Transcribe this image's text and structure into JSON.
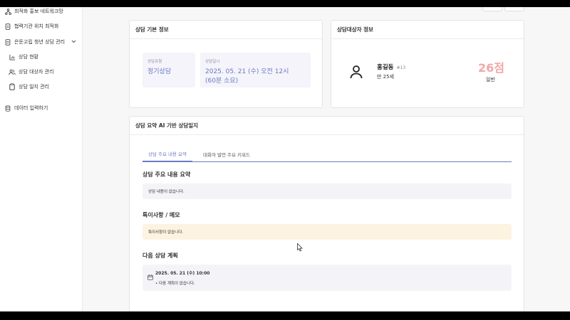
{
  "sidebar": {
    "items": [
      {
        "label": "최적화 홍보 네트워크망",
        "icon": "network-icon"
      },
      {
        "label": "협력기관 위치 최적화",
        "icon": "document-icon"
      },
      {
        "label": "은둔고립 청년 상담 관리",
        "icon": "document-icon"
      },
      {
        "label": "상담 현황",
        "icon": "chart-icon"
      },
      {
        "label": "상담 대상자 관리",
        "icon": "users-icon"
      },
      {
        "label": "상담 일지 관리",
        "icon": "clipboard-icon"
      },
      {
        "label": "데이터 입력하기",
        "icon": "database-icon"
      }
    ]
  },
  "basic_info": {
    "header": "상담 기본 정보",
    "type_label": "상담유형",
    "type_value": "정기상담",
    "datetime_label": "상담일시",
    "datetime_value": "2025. 05. 21 (수) 오전 12시",
    "duration_value": "(60분 소요)"
  },
  "client_info": {
    "header": "상담대상자 정보",
    "name": "홍길동",
    "id_tag": "#13",
    "age": "만 25세",
    "score": "26점",
    "level": "일반"
  },
  "ai_summary": {
    "header": "상담 요약 AI 기반 상담일지",
    "tabs": [
      "상담 주요 내용 요약",
      "대화자 발언 주요 키워드"
    ],
    "summary_title": "상담 주요 내용 요약",
    "summary_text": "상담 내용이 없습니다.",
    "notes_title": "특이사항 / 메모",
    "notes_text": "특이사항이 없습니다.",
    "plan_title": "다음 상담 계획",
    "plan_date": "2025. 05. 21 (수) 10:00",
    "plan_text": "• 다음 계획이 없습니다."
  },
  "colors": {
    "accent": "#6c79c6",
    "score": "#f1a8a8",
    "notes_bg": "#fdf3e1",
    "box_bg": "#f4f4f8"
  }
}
